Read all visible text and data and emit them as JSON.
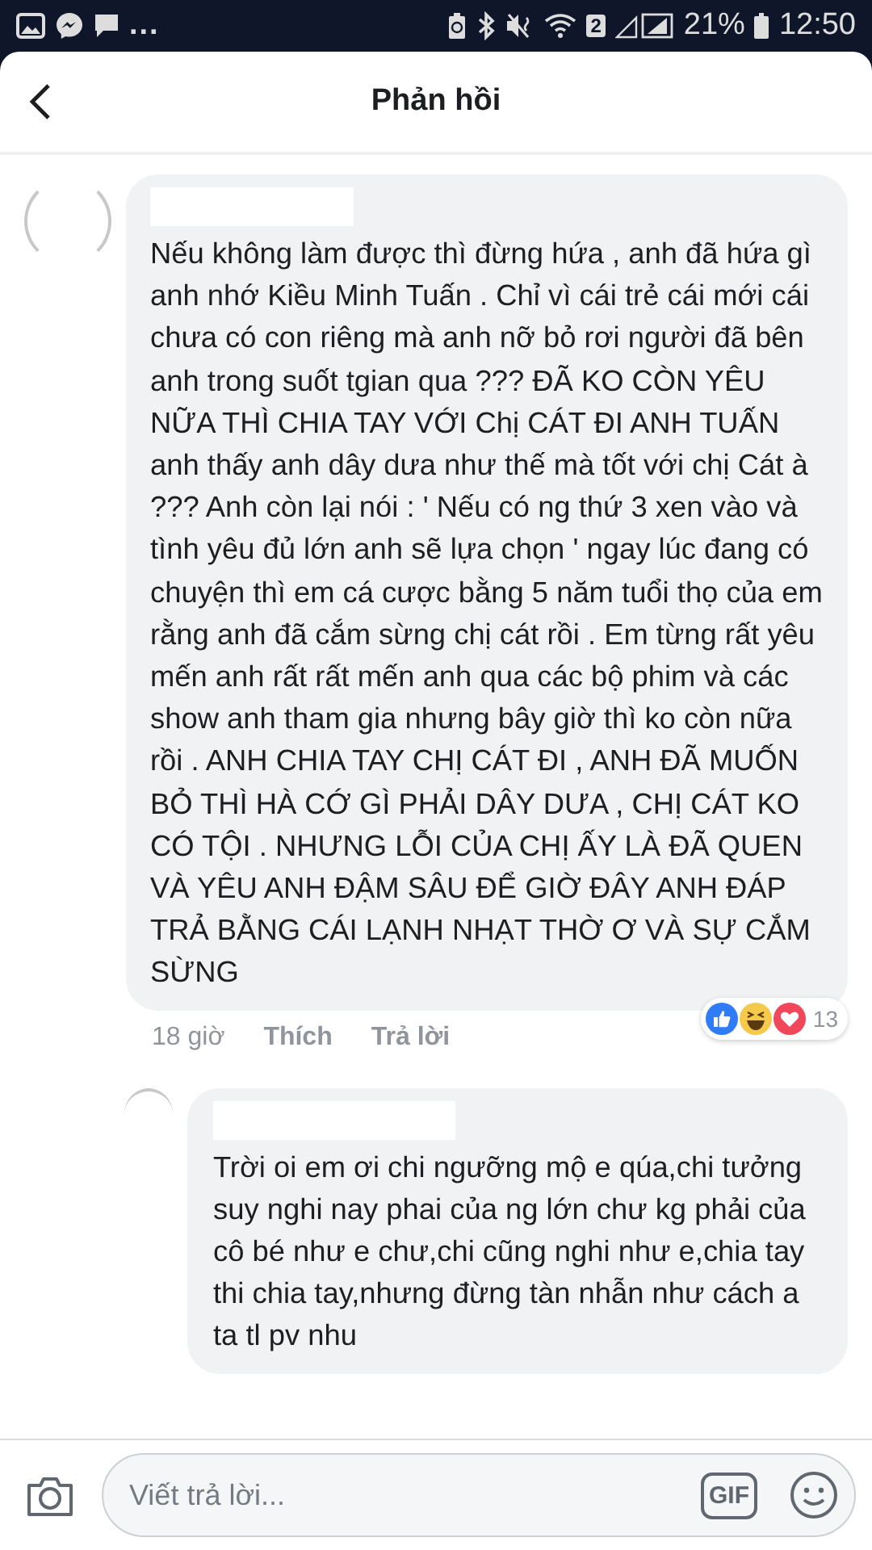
{
  "status_bar": {
    "more": "...",
    "sim": "2",
    "battery": "21%",
    "time": "12:50"
  },
  "header": {
    "title": "Phản hồi"
  },
  "comment": {
    "text": "Nếu không làm được thì đừng hứa , anh đã hứa gì anh nhớ Kiều Minh Tuấn . Chỉ vì cái trẻ cái mới cái chưa có con riêng mà anh nỡ bỏ rơi người đã bên anh trong suốt tgian qua ??? ĐÃ KO CÒN YÊU NỮA THÌ CHIA TAY VỚI Chị CÁT ĐI ANH TUẤN anh thấy anh dây dưa như thế mà tốt với chị Cát à ??? Anh còn lại nói : ' Nếu có ng thứ 3 xen vào và tình yêu đủ lớn anh sẽ lựa chọn ' ngay lúc đang có chuyện thì em cá cược bằng 5 năm tuổi thọ của em rằng anh đã cắm sừng chị cát rồi . Em từng rất yêu mến anh rất rất mến anh qua các bộ phim và các show anh tham gia nhưng bây giờ thì ko còn nữa rồi . ANH CHIA TAY CHỊ CÁT ĐI , ANH ĐÃ MUỐN BỎ THÌ HÀ CỚ GÌ PHẢI DÂY DƯA , CHỊ CÁT KO CÓ TỘI . NHƯNG LỖI CỦA CHỊ ẤY LÀ ĐÃ QUEN VÀ YÊU ANH ĐẬM SÂU ĐỂ GIỜ ĐÂY ANH ĐÁP TRẢ BẰNG CÁI LẠNH NHẠT THỜ Ơ VÀ SỰ CẮM SỪNG",
    "time": "18 giờ",
    "like": "Thích",
    "reply": "Trả lời",
    "reaction_count": "13"
  },
  "reply": {
    "text": "Trời oi em ơi chi ngưỡng mộ e qúa,chi tưởng suy nghi nay phai của ng lớn chư kg phải của cô bé như e chư,chi cũng nghi như e,chia tay thi chia tay,nhưng đừng tàn nhẫn như cách a ta tl pv nhu"
  },
  "composer": {
    "placeholder": "Viết trả lời...",
    "gif": "GIF"
  }
}
